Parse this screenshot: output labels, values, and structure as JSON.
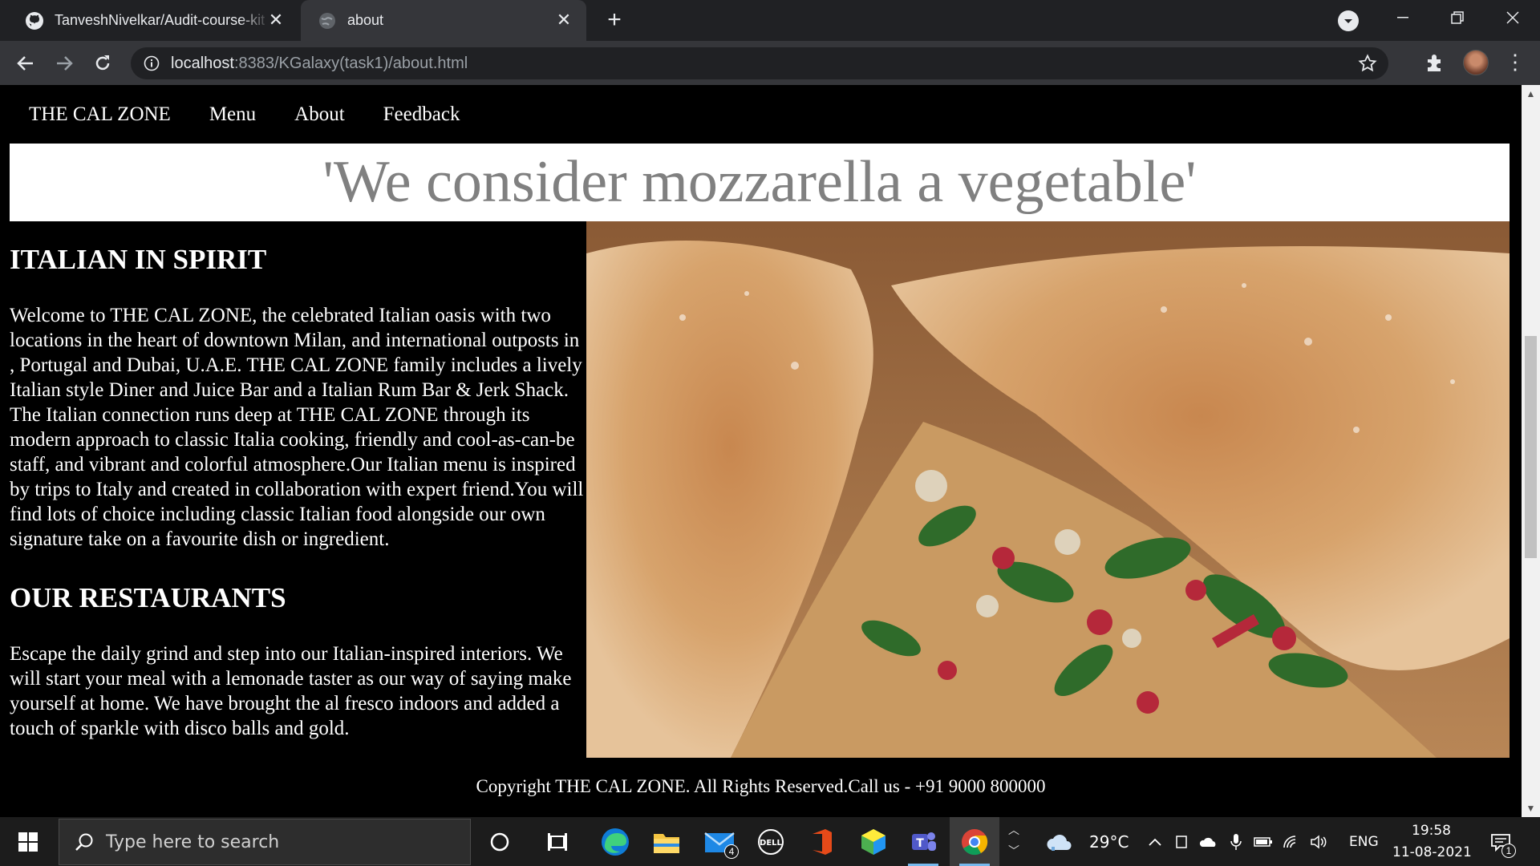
{
  "browser": {
    "tabs": [
      {
        "title": "TanveshNivelkar/Audit-course-kit",
        "close": "✕"
      },
      {
        "title": "about",
        "close": "✕"
      }
    ],
    "new_tab": "+",
    "url_host": "localhost",
    "url_rest": ":8383/KGalaxy(task1)/about.html",
    "menu": "⋮"
  },
  "site": {
    "nav": [
      "THE CAL ZONE",
      "Menu",
      "About",
      "Feedback"
    ],
    "banner": "'We consider mozzarella a vegetable'",
    "sections": [
      {
        "heading": "ITALIAN IN SPIRIT",
        "body": "Welcome to THE CAL ZONE, the celebrated Italian oasis with two locations in the heart of downtown Milan, and international outposts in , Portugal and Dubai, U.A.E. THE CAL ZONE family includes a lively Italian style Diner and Juice Bar and a Italian Rum Bar & Jerk Shack. The Italian connection runs deep at THE CAL ZONE through its modern approach to classic Italia cooking, friendly and cool-as-can-be staff, and vibrant and colorful atmosphere.Our Italian menu is inspired by trips to Italy and created in collaboration with expert friend.You will find lots of choice including classic Italian food alongside our own signature take on a favourite dish or ingredient."
      },
      {
        "heading": "OUR RESTAURANTS",
        "body": "Escape the daily grind and step into our Italian-inspired interiors. We will start your meal with a lemonade taster as our way of saying make yourself at home. We have brought the al fresco indoors and added a touch of sparkle with disco balls and gold."
      }
    ],
    "footer": "Copyright THE CAL ZONE. All Rights Reserved.Call us - +91 9000 800000"
  },
  "taskbar": {
    "search_placeholder": "Type here to search",
    "mail_badge": "4",
    "weather": "29°C",
    "language": "ENG",
    "time": "19:58",
    "date": "11-08-2021",
    "notifications_badge": "1"
  },
  "colors": {
    "page_bg": "#000000",
    "banner_bg": "#ffffff",
    "banner_text": "#808080",
    "chrome_dark": "#202124",
    "chrome_toolbar": "#35363a",
    "taskbar": "#1c1c1c"
  }
}
